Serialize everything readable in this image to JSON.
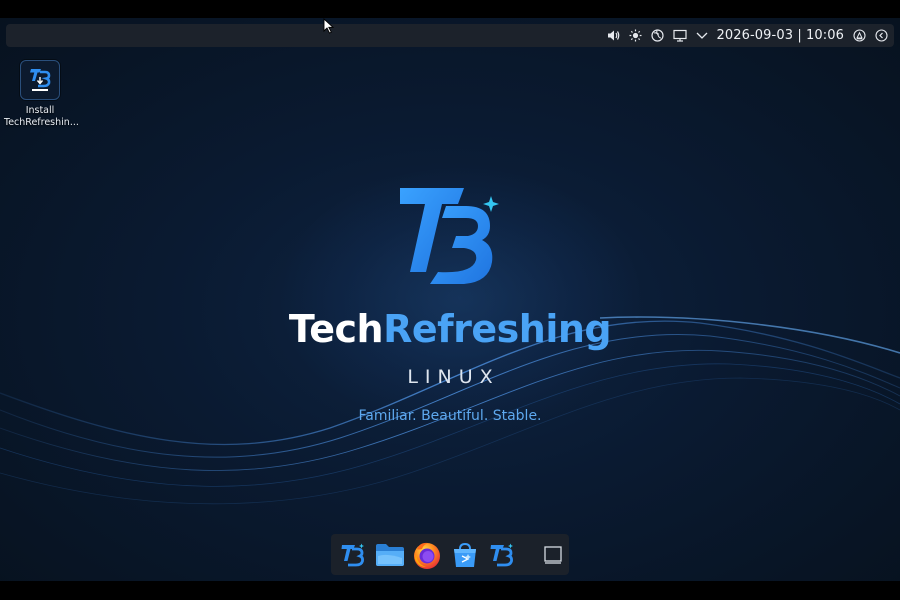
{
  "top_panel": {
    "clock": "2026-09-03 | 10:06",
    "tray_icons": [
      "volume-icon",
      "brightness-icon",
      "network-icon",
      "display-icon",
      "chevron-down-icon",
      "user-switch-icon",
      "power-icon"
    ]
  },
  "desktop": {
    "icons": [
      {
        "label_line1": "Install",
        "label_line2": "TechRefreshin...",
        "icon": "installer-icon"
      }
    ]
  },
  "branding": {
    "word1": "Tech",
    "word2": "Refreshing",
    "subtitle": "LINUX",
    "tagline": "Familiar. Beautiful. Stable."
  },
  "dock": {
    "items": [
      "app-menu-icon",
      "file-manager-icon",
      "firefox-icon",
      "software-store-icon",
      "welcome-app-icon",
      "show-desktop-icon"
    ]
  },
  "colors": {
    "accent": "#4aa3f5",
    "logo_blue": "#2f8ef0",
    "panel": "#1c222b",
    "background": "#0a1a31"
  }
}
